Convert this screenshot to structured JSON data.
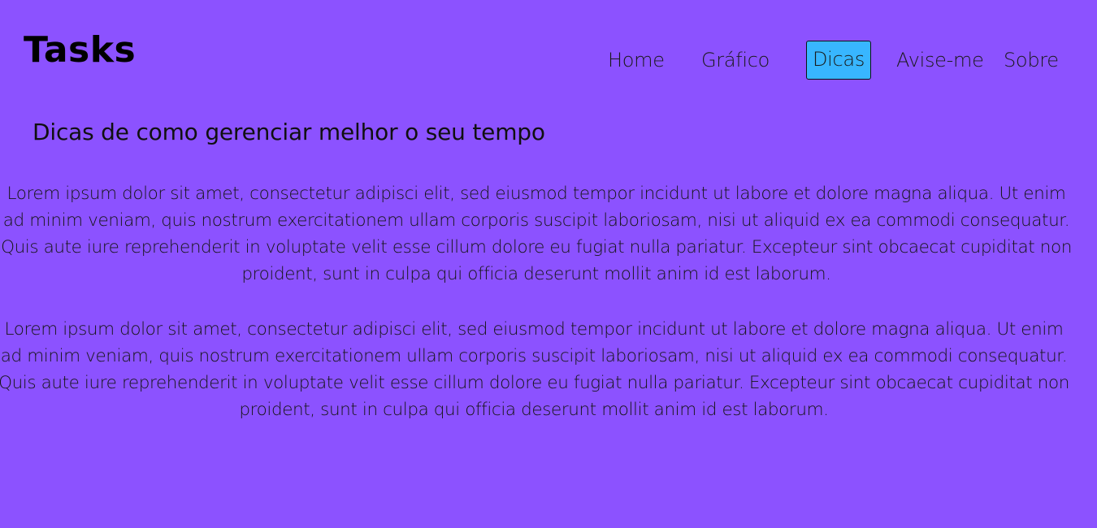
{
  "header": {
    "logo": "Tasks",
    "nav": [
      {
        "label": "Home",
        "active": false
      },
      {
        "label": "Gráfico",
        "active": false
      },
      {
        "label": "Dicas",
        "active": true
      },
      {
        "label": "Avise-me",
        "active": false
      },
      {
        "label": "Sobre",
        "active": false
      }
    ]
  },
  "main": {
    "title": "Dicas de como gerenciar melhor o seu tempo",
    "paragraphs": [
      "Lorem ipsum dolor sit amet, consectetur adipisci elit, sed eiusmod tempor incidunt ut labore et dolore magna aliqua. Ut enim ad minim veniam, quis nostrum exercitationem ullam corporis suscipit laboriosam, nisi ut aliquid ex ea commodi consequatur. Quis aute iure reprehenderit in voluptate velit esse cillum dolore eu fugiat nulla pariatur. Excepteur sint obcaecat cupiditat non proident, sunt in culpa qui officia deserunt mollit anim id est laborum.",
      "Lorem ipsum dolor sit amet, consectetur adipisci elit, sed eiusmod tempor incidunt ut labore et dolore magna aliqua. Ut enim ad minim veniam, quis nostrum exercitationem ullam corporis suscipit laboriosam, nisi ut aliquid ex ea commodi consequatur. Quis aute iure reprehenderit in voluptate velit esse cillum dolore eu fugiat nulla pariatur. Excepteur sint obcaecat cupiditat non proident, sunt in culpa qui officia deserunt mollit anim id est laborum."
    ]
  },
  "colors": {
    "background": "#8c52ff",
    "active_tab": "#38b6ff",
    "text": "#000000"
  }
}
